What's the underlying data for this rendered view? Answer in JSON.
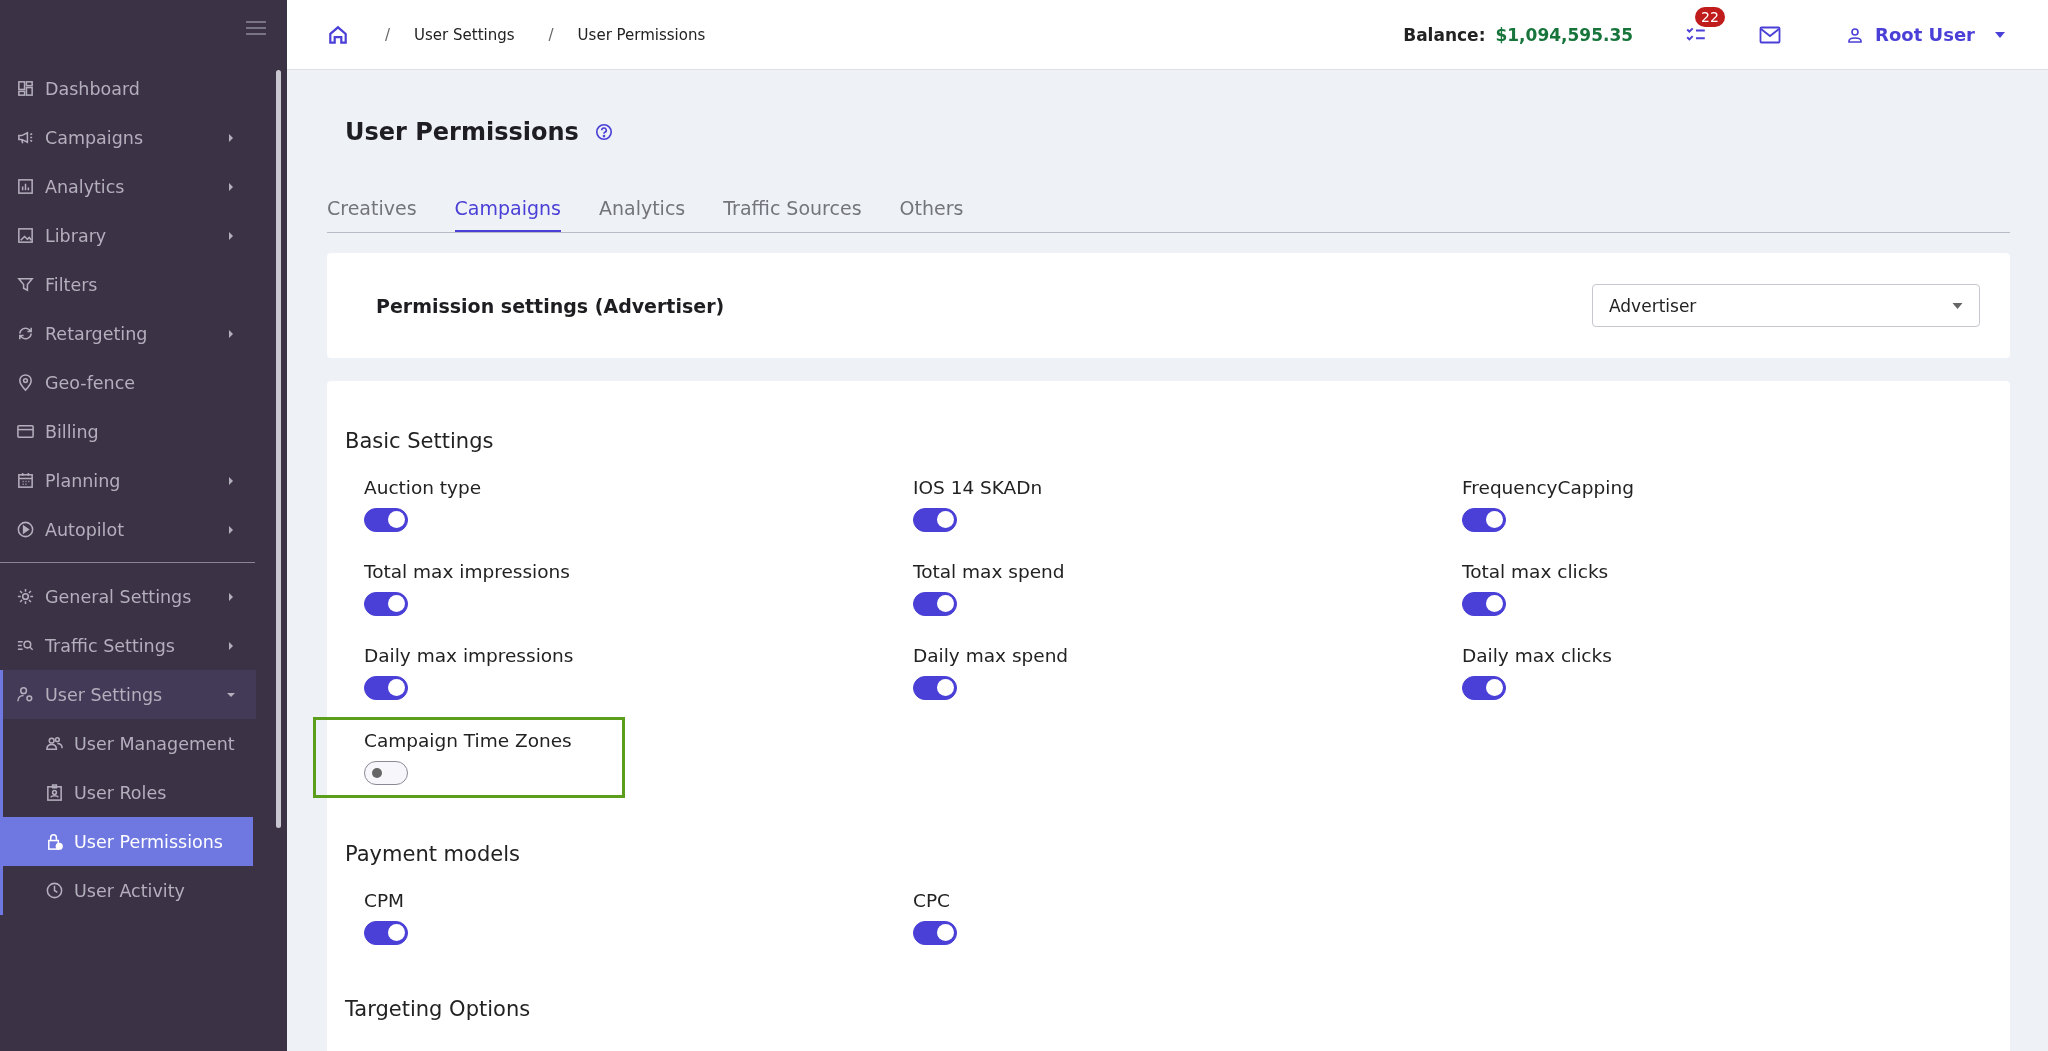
{
  "sidebar": {
    "sections": [
      [
        {
          "label": "Dashboard"
        },
        {
          "label": "Campaigns",
          "expanded": false
        },
        {
          "label": "Analytics",
          "expanded": false
        },
        {
          "label": "Library",
          "expanded": false
        },
        {
          "label": "Filters"
        },
        {
          "label": "Retargeting",
          "expanded": false
        },
        {
          "label": "Geo-fence"
        },
        {
          "label": "Billing"
        },
        {
          "label": "Planning",
          "expanded": false
        },
        {
          "label": "Autopilot",
          "expanded": false
        }
      ],
      [
        {
          "label": "General Settings",
          "expanded": false
        },
        {
          "label": "Traffic Settings",
          "expanded": false
        },
        {
          "label": "User Settings",
          "expanded": true,
          "children": [
            {
              "label": "User Management",
              "selected": false
            },
            {
              "label": "User Roles",
              "selected": false
            },
            {
              "label": "User Permissions",
              "selected": true
            },
            {
              "label": "User Activity",
              "selected": false
            }
          ]
        }
      ]
    ]
  },
  "breadcrumb": [
    {
      "separator": "/",
      "label": "User Settings"
    },
    {
      "separator": "/",
      "label": "User Permissions"
    }
  ],
  "header": {
    "balance_label": "Balance:",
    "balance_value": "$1,094,595.35",
    "tasks_badge": "22",
    "user": "Root User"
  },
  "page_title": "User Permissions",
  "tabs": [
    {
      "label": "Creatives",
      "selected": false
    },
    {
      "label": "Campaigns",
      "selected": true
    },
    {
      "label": "Analytics",
      "selected": false
    },
    {
      "label": "Traffic Sources",
      "selected": false
    },
    {
      "label": "Others",
      "selected": false
    }
  ],
  "permission_settings": {
    "title": "Permission settings (Advertiser)",
    "role_select": "Advertiser"
  },
  "sections": [
    {
      "title": "Basic Settings",
      "items": [
        {
          "label": "Auction type",
          "on": true,
          "highlighted": false
        },
        {
          "label": "IOS 14 SKADn",
          "on": true,
          "highlighted": false
        },
        {
          "label": "FrequencyCapping",
          "on": true,
          "highlighted": false
        },
        {
          "label": "Total max impressions",
          "on": true,
          "highlighted": false
        },
        {
          "label": "Total max spend",
          "on": true,
          "highlighted": false
        },
        {
          "label": "Total max clicks",
          "on": true,
          "highlighted": false
        },
        {
          "label": "Daily max impressions",
          "on": true,
          "highlighted": false
        },
        {
          "label": "Daily max spend",
          "on": true,
          "highlighted": false
        },
        {
          "label": "Daily max clicks",
          "on": true,
          "highlighted": false
        },
        {
          "label": "Campaign Time Zones",
          "on": false,
          "highlighted": true
        }
      ]
    },
    {
      "title": "Payment models",
      "items": [
        {
          "label": "CPM",
          "on": true,
          "highlighted": false
        },
        {
          "label": "CPC",
          "on": true,
          "highlighted": false
        }
      ]
    },
    {
      "title": "Targeting Options"
    }
  ]
}
